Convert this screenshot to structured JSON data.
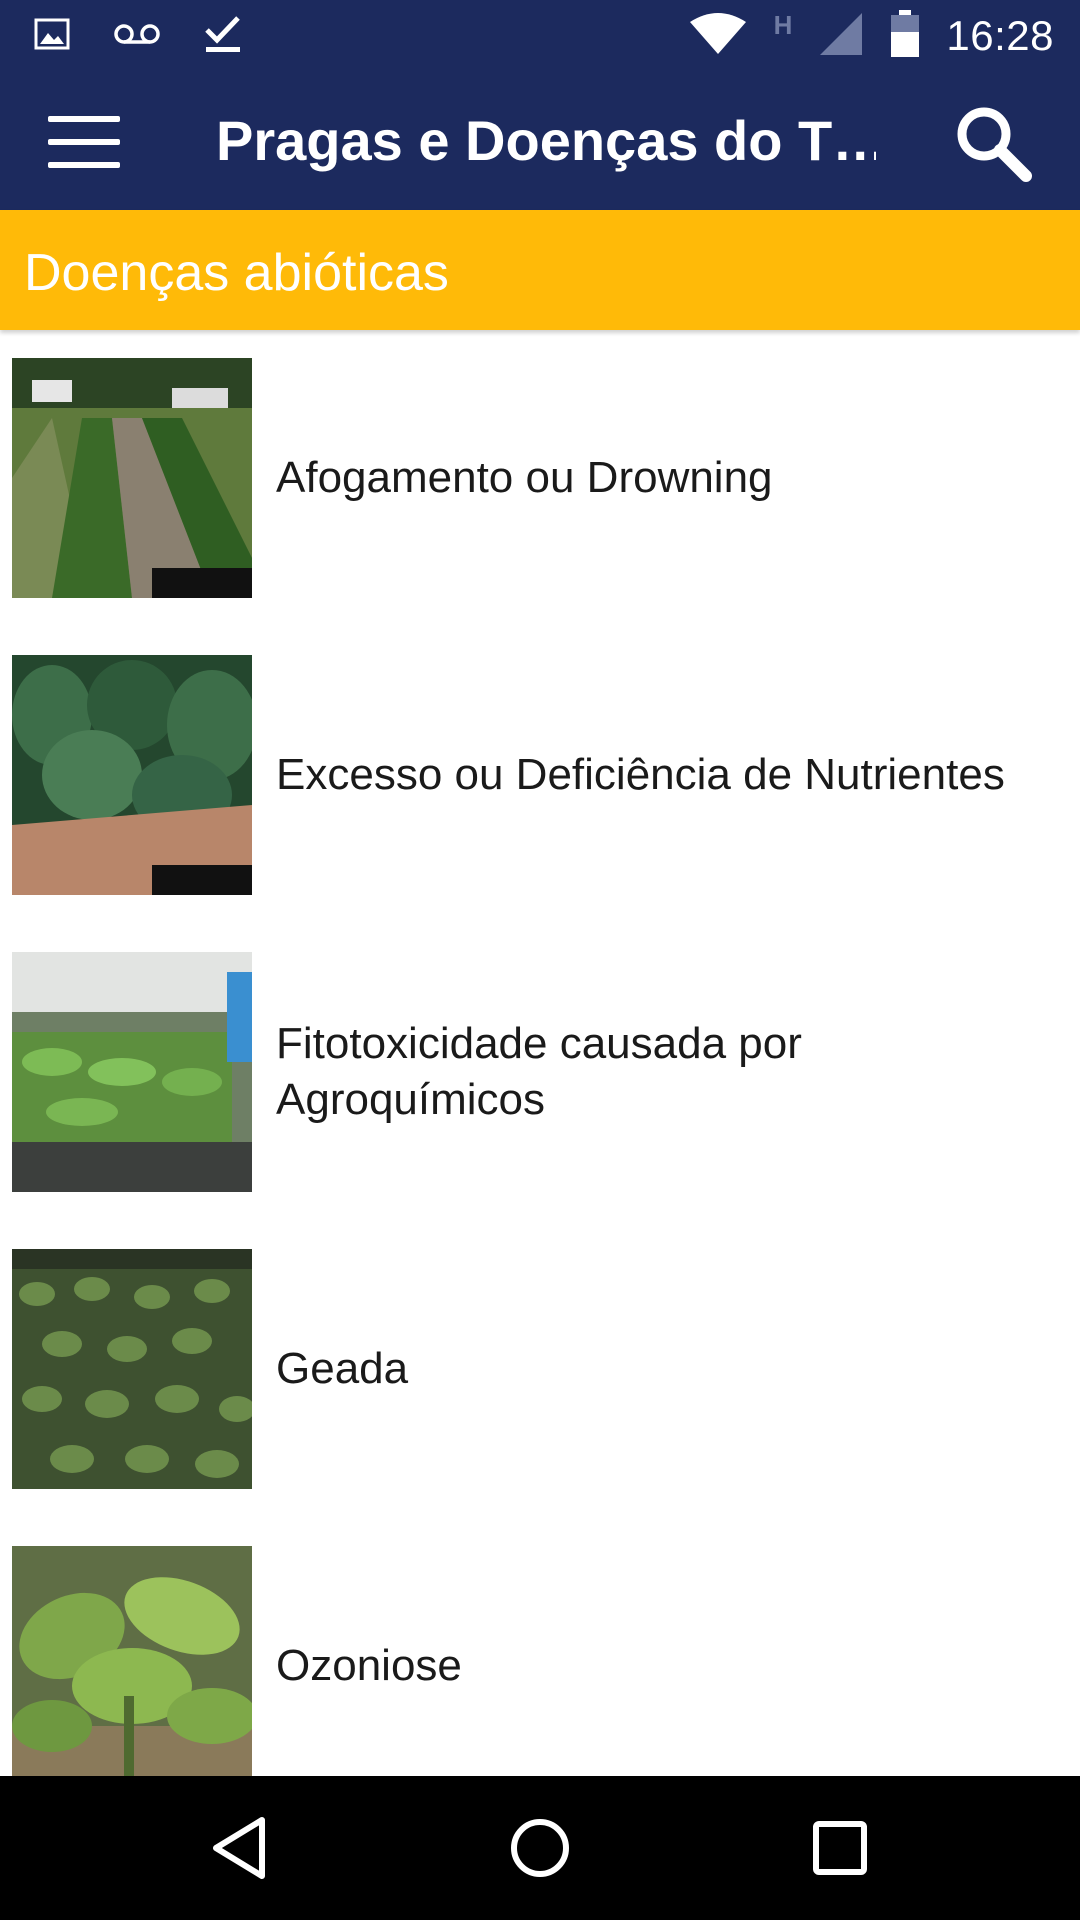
{
  "status_bar": {
    "time": "16:28",
    "network_label": "H",
    "icons_left": [
      "image-icon",
      "voicemail-icon",
      "check-icon"
    ],
    "icons_right": [
      "wifi-icon",
      "signal-icon",
      "battery-icon"
    ]
  },
  "app_bar": {
    "title": "Pragas e Doenças do T…",
    "menu_icon": "hamburger-menu-icon",
    "search_icon": "search-icon"
  },
  "section": {
    "title": "Doenças abióticas",
    "color": "#ffba08"
  },
  "items": [
    {
      "label": "Afogamento ou Drowning",
      "thumbnail": "tobacco-field-rows"
    },
    {
      "label": "Excesso ou Deficiência de Nutrientes",
      "thumbnail": "tobacco-plants-row"
    },
    {
      "label": "Fitotoxicidade causada por Agroquímicos",
      "thumbnail": "seedling-trays-greenhouse"
    },
    {
      "label": "Geada",
      "thumbnail": "frost-damaged-seedlings"
    },
    {
      "label": "Ozoniose",
      "thumbnail": "tobacco-plant-closeup"
    }
  ],
  "nav_bar": {
    "back_icon": "back-icon",
    "home_icon": "home-icon",
    "recents_icon": "recents-icon"
  },
  "colors": {
    "primary": "#1c2a5e",
    "accent": "#ffba08"
  }
}
